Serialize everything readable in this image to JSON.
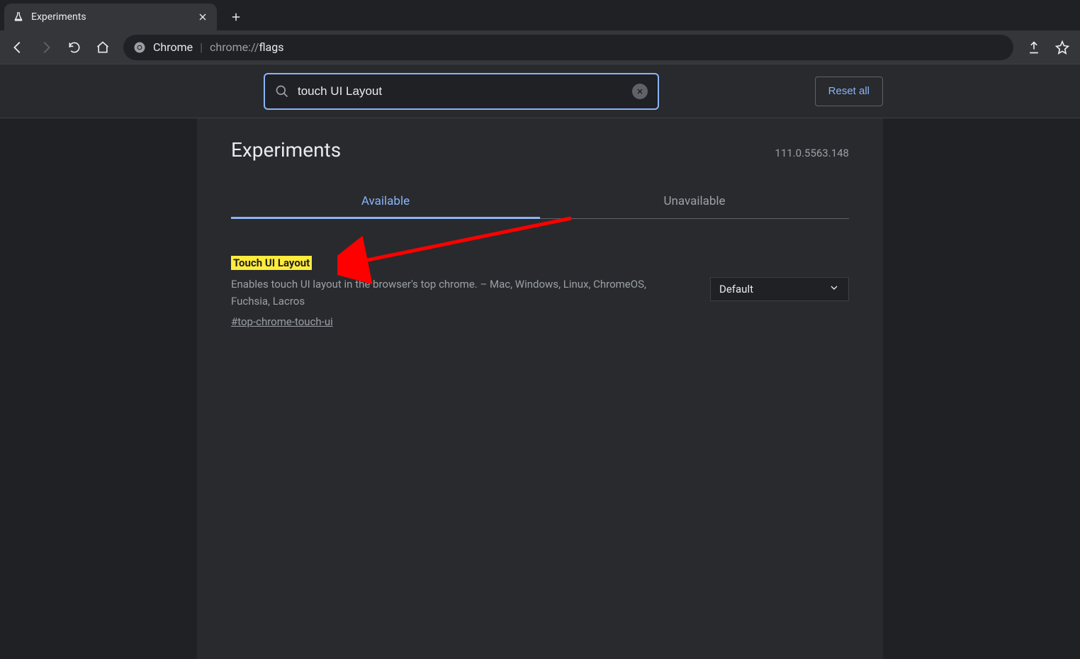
{
  "browser": {
    "tab_title": "Experiments",
    "omnibox": {
      "chip": "Chrome",
      "url_dim": "chrome://",
      "url_bright": "flags"
    }
  },
  "subbar": {
    "search_value": "touch UI Layout",
    "reset_label": "Reset all"
  },
  "panel": {
    "heading": "Experiments",
    "version": "111.0.5563.148",
    "tabs": {
      "available": "Available",
      "unavailable": "Unavailable"
    }
  },
  "flag": {
    "title": "Touch UI Layout",
    "description": "Enables touch UI layout in the browser's top chrome. – Mac, Windows, Linux, ChromeOS, Fuchsia, Lacros",
    "hash": "#top-chrome-touch-ui",
    "select_value": "Default"
  }
}
